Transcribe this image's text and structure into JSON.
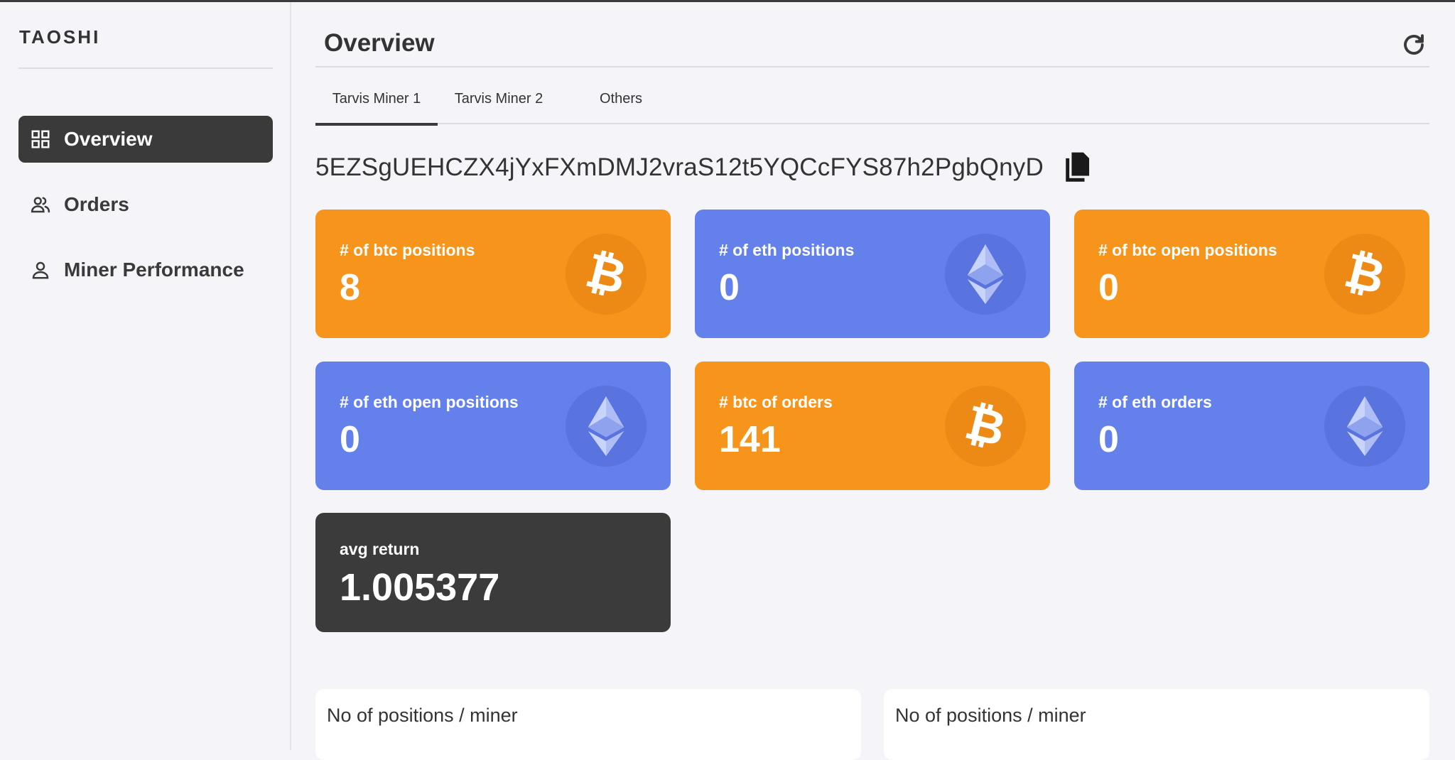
{
  "sidebar": {
    "logo": "TAOSHI",
    "items": [
      {
        "label": "Overview",
        "icon": "grid-icon",
        "active": true
      },
      {
        "label": "Orders",
        "icon": "users-icon",
        "active": false
      },
      {
        "label": "Miner Performance",
        "icon": "user-icon",
        "active": false
      }
    ]
  },
  "header": {
    "title": "Overview",
    "refresh_icon": "refresh-icon"
  },
  "tabs": [
    {
      "label": "Tarvis Miner 1",
      "active": true
    },
    {
      "label": "Tarvis Miner 2",
      "active": false
    },
    {
      "label": "Others",
      "active": false
    }
  ],
  "address": {
    "value": "5EZSgUEHCZX4jYxFXmDMJ2vraS12t5YQCcFYS87h2PgbQnyD",
    "copy_icon": "copy-icon"
  },
  "cards": [
    {
      "label": "# of btc positions",
      "value": "8",
      "color": "#f6941c",
      "icon": "bitcoin-icon"
    },
    {
      "label": "# of eth positions",
      "value": "0",
      "color": "#6480ea",
      "icon": "ethereum-icon"
    },
    {
      "label": "# of btc open positions",
      "value": "0",
      "color": "#f6941c",
      "icon": "bitcoin-icon"
    },
    {
      "label": "# of eth open positions",
      "value": "0",
      "color": "#6480ea",
      "icon": "ethereum-icon"
    },
    {
      "label": "# btc of orders",
      "value": "141",
      "color": "#f6941c",
      "icon": "bitcoin-icon"
    },
    {
      "label": "# of eth orders",
      "value": "0",
      "color": "#6480ea",
      "icon": "ethereum-icon"
    },
    {
      "label": "avg return",
      "value": "1.005377",
      "color": "#3b3b3b"
    }
  ],
  "panels": [
    {
      "title": "No of positions / miner"
    },
    {
      "title": "No of positions / miner"
    }
  ]
}
